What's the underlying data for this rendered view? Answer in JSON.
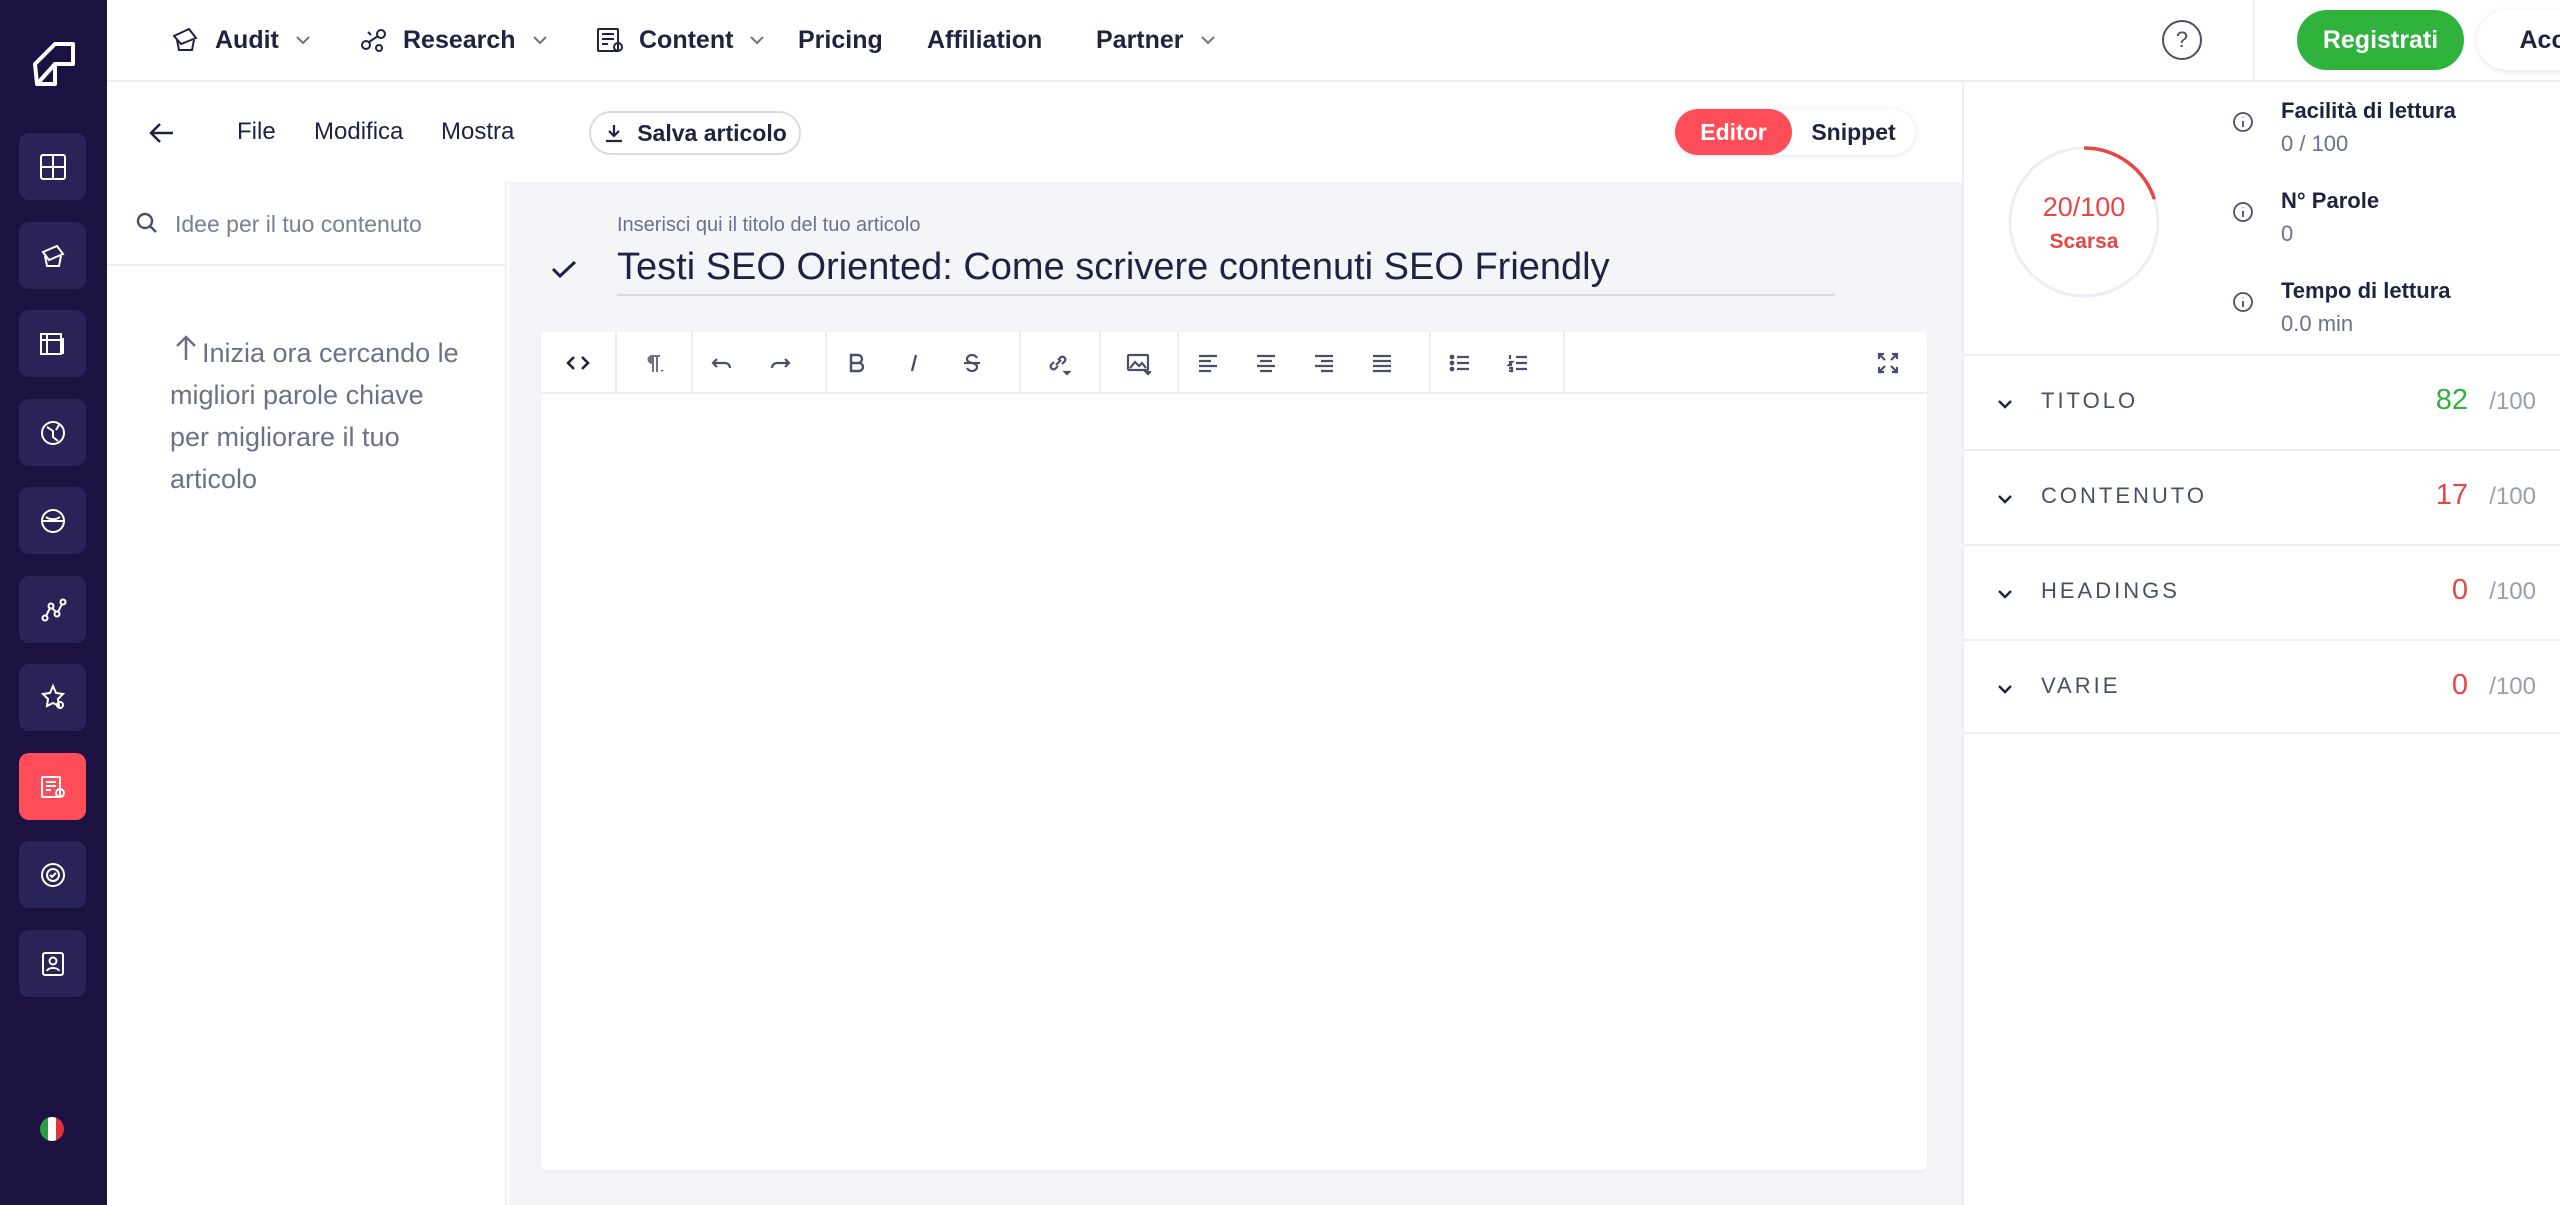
{
  "nav": {
    "items": [
      {
        "label": "Audit",
        "icon": "audit-icon",
        "dropdown": true
      },
      {
        "label": "Research",
        "icon": "research-icon",
        "dropdown": true
      },
      {
        "label": "Content",
        "icon": "content-icon",
        "dropdown": true
      },
      {
        "label": "Pricing",
        "dropdown": false
      },
      {
        "label": "Affiliation",
        "dropdown": false
      },
      {
        "label": "Partner",
        "dropdown": true
      }
    ],
    "help_symbol": "?",
    "register_label": "Registrati",
    "login_label": "Accedi"
  },
  "sidebar": {
    "icons": [
      "dashboard-icon",
      "audit-icon",
      "content-grid-icon",
      "globe-icon",
      "compass-icon",
      "network-icon",
      "star-settings-icon",
      "article-edit-icon",
      "target-icon",
      "profile-icon"
    ],
    "active": "article-edit-icon",
    "language": "it"
  },
  "editor_bar": {
    "menu": [
      "File",
      "Modifica",
      "Mostra"
    ],
    "save_label": "Salva articolo",
    "toggle": {
      "editor": "Editor",
      "snippet": "Snippet",
      "active": "Editor"
    }
  },
  "ideas": {
    "placeholder": "Idee per il tuo contenuto",
    "hint": "Inizia ora cercando le migliori parole chiave per migliorare il tuo articolo"
  },
  "article": {
    "title_hint": "Inserisci qui il titolo del tuo articolo",
    "title": "Testi SEO Oriented: Come scrivere contenuti SEO Friendly"
  },
  "score": {
    "value": "20/100",
    "fraction": 0.2,
    "label": "Scarsa",
    "metrics": [
      {
        "label": "Facilità di lettura",
        "value": "0 / 100"
      },
      {
        "label": "N° Parole",
        "value": "0"
      },
      {
        "label": "Tempo di lettura",
        "value": "0.0 min"
      }
    ],
    "categories": [
      {
        "name": "TITOLO",
        "score": "82",
        "max": "/100",
        "color": "#2fb33d"
      },
      {
        "name": "CONTENUTO",
        "score": "17",
        "max": "/100",
        "color": "#e84545"
      },
      {
        "name": "HEADINGS",
        "score": "0",
        "max": "/100",
        "color": "#e84545"
      },
      {
        "name": "VARIE",
        "score": "0",
        "max": "/100",
        "color": "#e84545"
      }
    ]
  },
  "colors": {
    "accent_red": "#ff4d5a",
    "brand_green": "#2fb33d",
    "sidebar_bg": "#1b1242"
  }
}
